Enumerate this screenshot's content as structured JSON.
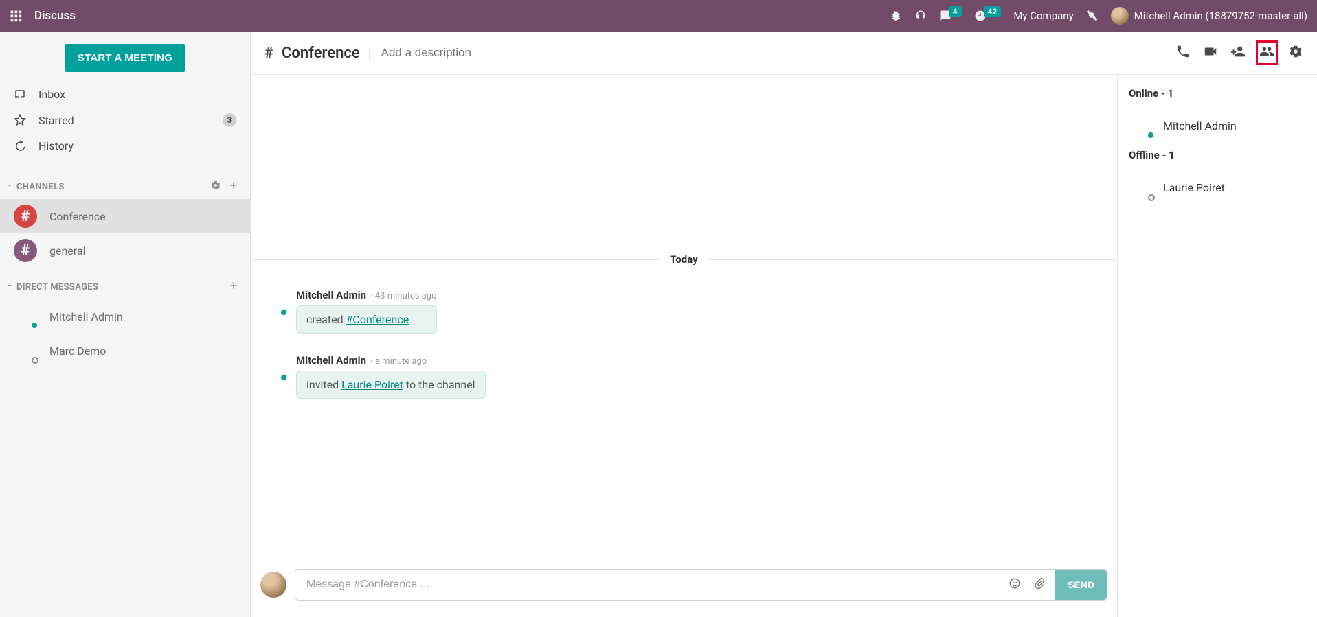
{
  "app": {
    "title": "Discuss"
  },
  "navbar": {
    "msg_badge": "4",
    "timer_badge": "42",
    "company": "My Company",
    "user": "Mitchell Admin (18879752-master-all)"
  },
  "sidebar": {
    "meeting_btn": "START A MEETING",
    "mailboxes": {
      "inbox": "Inbox",
      "starred": "Starred",
      "starred_count": "3",
      "history": "History"
    },
    "channels_header": "CHANNELS",
    "channels": [
      {
        "name": "Conference"
      },
      {
        "name": "general"
      }
    ],
    "dm_header": "DIRECT MESSAGES",
    "dms": [
      {
        "name": "Mitchell Admin"
      },
      {
        "name": "Marc Demo"
      }
    ]
  },
  "thread": {
    "hash": "#",
    "title": "Conference",
    "desc_placeholder": "Add a description",
    "day_label": "Today",
    "messages": [
      {
        "author": "Mitchell Admin",
        "time": "- 43 minutes ago",
        "text_prefix": "created ",
        "link": "#Conference",
        "text_suffix": ""
      },
      {
        "author": "Mitchell Admin",
        "time": "- a minute ago",
        "text_prefix": "invited ",
        "link": "Laurie Poiret",
        "text_suffix": " to the channel"
      }
    ],
    "composer_placeholder": "Message #Conference ...",
    "send_label": "SEND"
  },
  "members": {
    "online_label": "Online - 1",
    "online": [
      {
        "name": "Mitchell Admin"
      }
    ],
    "offline_label": "Offline - 1",
    "offline": [
      {
        "name": "Laurie Poiret"
      }
    ]
  }
}
